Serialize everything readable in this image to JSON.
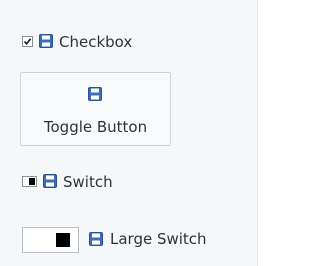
{
  "checkbox": {
    "label": "Checkbox",
    "checked": true,
    "icon": "floppy-disk-icon"
  },
  "toggle_button": {
    "label": "Toggle Button",
    "icon": "floppy-disk-icon"
  },
  "switch": {
    "label": "Switch",
    "state": "on",
    "icon": "floppy-disk-icon"
  },
  "large_switch": {
    "label": "Large Switch",
    "state": "on",
    "icon": "floppy-disk-icon"
  },
  "colors": {
    "icon_blue": "#3f6cb8",
    "panel_bg": "#f5f7f9",
    "knob": "#000000"
  }
}
